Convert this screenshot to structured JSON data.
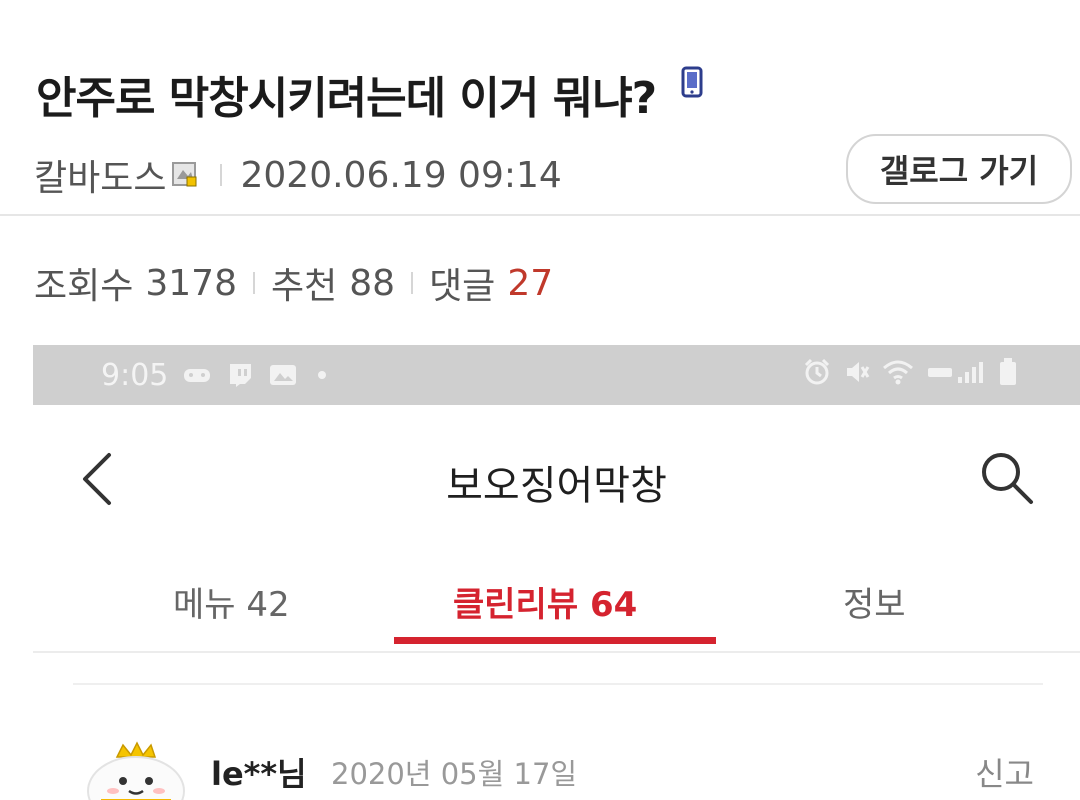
{
  "post": {
    "title": "안주로 막창시키려는데 이거 뭐냐?",
    "author": "칼바도스",
    "datetime": "2020.06.19 09:14",
    "gallog_button": "갤로그 가기"
  },
  "stats": {
    "views_label": "조회수",
    "views": "3178",
    "recommend_label": "추천",
    "recommend": "88",
    "comments_label": "댓글",
    "comments": "27"
  },
  "screenshot": {
    "status_time": "9:05",
    "app_title": "보오징어막창",
    "tabs": [
      {
        "label": "메뉴 42"
      },
      {
        "label": "클린리뷰 64"
      },
      {
        "label": "정보"
      }
    ],
    "review": {
      "reviewer": "le**님",
      "date": "2020년 05월 17일",
      "report": "신고"
    }
  },
  "colors": {
    "accent": "#d5232f",
    "comment_count": "#c0392b"
  }
}
